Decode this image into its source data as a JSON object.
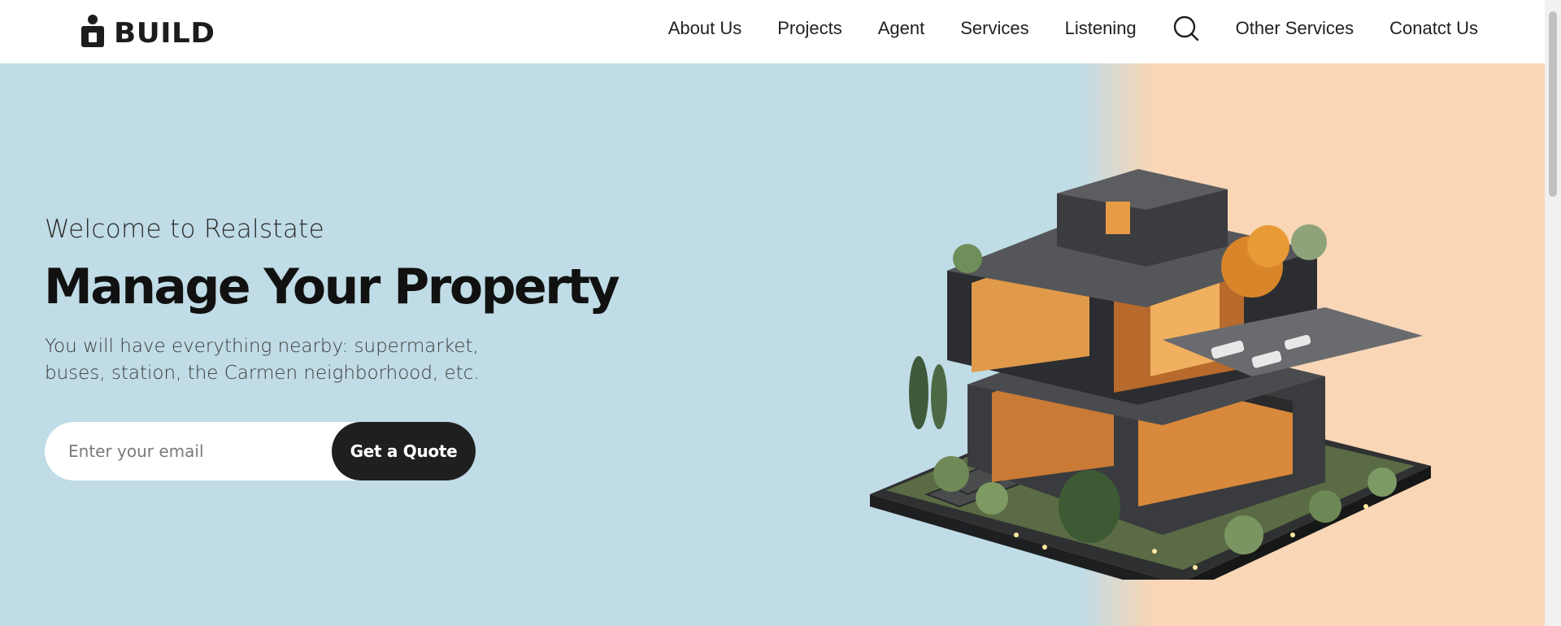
{
  "brand": {
    "name": "BUILD"
  },
  "nav": {
    "items": [
      {
        "label": "About Us"
      },
      {
        "label": "Projects"
      },
      {
        "label": "Agent"
      },
      {
        "label": "Services"
      },
      {
        "label": "Listening"
      },
      {
        "label": "Other Services"
      },
      {
        "label": "Conatct Us"
      }
    ],
    "search_icon": "search-icon"
  },
  "hero": {
    "welcome": "Welcome to Realstate",
    "headline": "Manage Your Property",
    "subtext": "You will have everything nearby: supermarket, buses, station, the Carmen neighborhood, etc.",
    "email_placeholder": "Enter your email",
    "cta_label": "Get a Quote",
    "image": "modern-house-illustration"
  },
  "colors": {
    "hero_left": "#c0dce6",
    "hero_right": "#f8d6b6",
    "button_bg": "#1f1f1f",
    "text_dark": "#111111"
  }
}
